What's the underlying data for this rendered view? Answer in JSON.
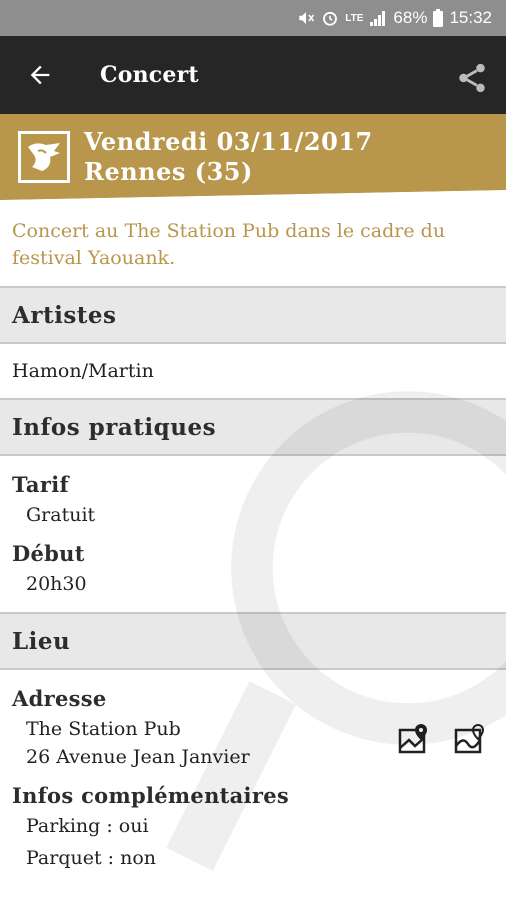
{
  "status_bar": {
    "battery": "68%",
    "time": "15:32",
    "network": "LTE"
  },
  "app_bar": {
    "title": "Concert"
  },
  "event": {
    "date_line": "Vendredi 03/11/2017",
    "location_line": "Rennes (35)"
  },
  "description": "Concert au The Station Pub dans le cadre du festival Yaouank.",
  "sections": {
    "artistes": {
      "title": "Artistes",
      "value": "Hamon/Martin"
    },
    "infos": {
      "title": "Infos pratiques",
      "tarif_label": "Tarif",
      "tarif_value": "Gratuit",
      "debut_label": "Début",
      "debut_value": "20h30"
    },
    "lieu": {
      "title": "Lieu",
      "adresse_label": "Adresse",
      "adresse_line1": "The Station Pub",
      "adresse_line2": "26 Avenue Jean Janvier",
      "complement_label": "Infos complémentaires",
      "parking": "Parking : oui",
      "parquet": "Parquet : non"
    }
  },
  "colors": {
    "accent": "#b8964b",
    "appbar": "#262626",
    "statusbar": "#8e8e8e",
    "section_bg": "#e8e8e8"
  }
}
